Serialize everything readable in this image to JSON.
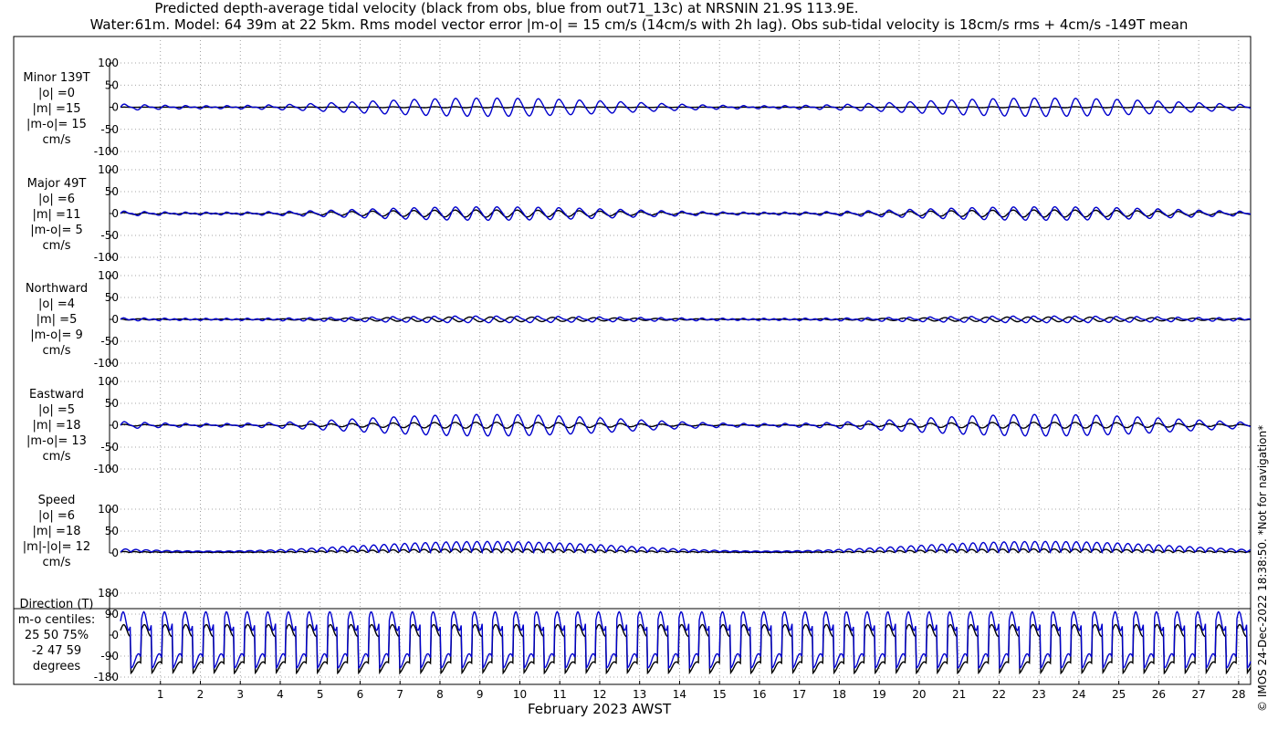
{
  "title_line1": "Predicted depth-average tidal velocity (black from obs, blue from out71_13c) at NRSNIN 21.9S 113.9E.",
  "title_line2": "Water:61m. Model: 64 39m at 22 5km. Rms model vector error |m-o| = 15 cm/s (14cm/s with 2h lag). Obs sub-tidal velocity is 18cm/s rms + 4cm/s -149T mean",
  "side_note": "© IMOS 24-Dec-2022 18:38:50. *Not for navigation*",
  "x_axis_label": "February 2023 AWST",
  "colors": {
    "obs": "#000000",
    "model": "#0000cc",
    "grid": "#888888"
  },
  "panels": [
    {
      "label_lines": [
        "Minor 139T",
        "|o| =0",
        "|m| =15",
        "|m-o|= 15",
        "cm/s"
      ]
    },
    {
      "label_lines": [
        "Major 49T",
        "|o| =6",
        "|m| =11",
        "|m-o|= 5",
        "cm/s"
      ]
    },
    {
      "label_lines": [
        "Northward",
        "|o| =4",
        "|m| =5",
        "|m-o|= 9",
        "cm/s"
      ]
    },
    {
      "label_lines": [
        "Eastward",
        "|o| =5",
        "|m| =18",
        "|m-o|= 13",
        "cm/s"
      ]
    },
    {
      "label_lines": [
        "Speed",
        "|o| =6",
        "|m| =18",
        "|m|-|o|= 12",
        "cm/s"
      ]
    },
    {
      "label_lines": [
        "Direction (T)",
        "m-o centiles:",
        "25  50  75%",
        "-2  47  59",
        "degrees"
      ]
    }
  ],
  "chart_data": [
    {
      "type": "line",
      "title": "Minor 139T",
      "xlim": [
        0,
        28.3
      ],
      "ylim": [
        -100,
        100
      ],
      "yticks": [
        -100,
        -50,
        0,
        50,
        100
      ],
      "series_names": [
        "obs",
        "model"
      ],
      "obs_amplitude_cm_s": 0,
      "model_amplitude_cm_s": 15
    },
    {
      "type": "line",
      "title": "Major 49T",
      "xlim": [
        0,
        28.3
      ],
      "ylim": [
        -100,
        100
      ],
      "yticks": [
        -100,
        -50,
        0,
        50,
        100
      ],
      "series_names": [
        "obs",
        "model"
      ],
      "obs_amplitude_cm_s": 6,
      "model_amplitude_cm_s": 11
    },
    {
      "type": "line",
      "title": "Northward",
      "xlim": [
        0,
        28.3
      ],
      "ylim": [
        -100,
        100
      ],
      "yticks": [
        -100,
        -50,
        0,
        50,
        100
      ],
      "series_names": [
        "obs",
        "model"
      ],
      "obs_amplitude_cm_s": 4,
      "model_amplitude_cm_s": 5
    },
    {
      "type": "line",
      "title": "Eastward",
      "xlim": [
        0,
        28.3
      ],
      "ylim": [
        -100,
        100
      ],
      "yticks": [
        -100,
        -50,
        0,
        50,
        100
      ],
      "series_names": [
        "obs",
        "model"
      ],
      "obs_amplitude_cm_s": 5,
      "model_amplitude_cm_s": 18
    },
    {
      "type": "line",
      "title": "Speed",
      "xlim": [
        0,
        28.3
      ],
      "ylim": [
        0,
        100
      ],
      "yticks": [
        0,
        50,
        100
      ],
      "series_names": [
        "obs",
        "model"
      ],
      "obs_amplitude_cm_s": 6,
      "model_amplitude_cm_s": 18
    },
    {
      "type": "line",
      "title": "Direction (T)",
      "xlim": [
        0,
        28.3
      ],
      "ylim": [
        -180,
        180
      ],
      "yticks": [
        -180,
        -90,
        0,
        90,
        180
      ],
      "series_names": [
        "obs",
        "model"
      ]
    }
  ],
  "x_ticks": [
    1,
    2,
    3,
    4,
    5,
    6,
    7,
    8,
    9,
    10,
    11,
    12,
    13,
    14,
    15,
    16,
    17,
    18,
    19,
    20,
    21,
    22,
    23,
    24,
    25,
    26,
    27,
    28
  ]
}
